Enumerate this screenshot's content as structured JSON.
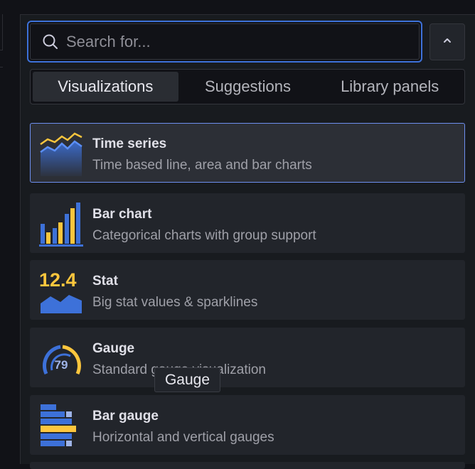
{
  "search": {
    "placeholder": "Search for..."
  },
  "tabs": [
    {
      "label": "Visualizations",
      "active": true
    },
    {
      "label": "Suggestions",
      "active": false
    },
    {
      "label": "Library panels",
      "active": false
    }
  ],
  "visualizations": [
    {
      "title": "Time series",
      "description": "Time based line, area and bar charts",
      "icon": "time-series-icon",
      "selected": true
    },
    {
      "title": "Bar chart",
      "description": "Categorical charts with group support",
      "icon": "bar-chart-icon"
    },
    {
      "title": "Stat",
      "description": "Big stat values & sparklines",
      "icon": "stat-icon",
      "icon_text": "12.4"
    },
    {
      "title": "Gauge",
      "description": "Standard gauge visualization",
      "icon": "gauge-icon",
      "icon_text": "79"
    },
    {
      "title": "Bar gauge",
      "description": "Horizontal and vertical gauges",
      "icon": "bar-gauge-icon"
    }
  ],
  "tooltip": {
    "text": "Gauge"
  },
  "colors": {
    "accent": "#3d71d9",
    "selected_border": "#6e8ff0",
    "yellow": "#fdc63d",
    "blue": "#3d71d9"
  }
}
